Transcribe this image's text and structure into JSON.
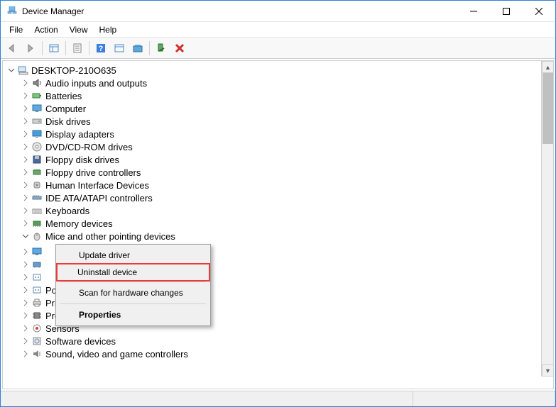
{
  "window": {
    "title": "Device Manager"
  },
  "menu": {
    "items": [
      "File",
      "Action",
      "View",
      "Help"
    ]
  },
  "root": {
    "name": "DESKTOP-210O635"
  },
  "categories": [
    {
      "label": "Audio inputs and outputs",
      "icon": "speaker-icon"
    },
    {
      "label": "Batteries",
      "icon": "battery-icon"
    },
    {
      "label": "Computer",
      "icon": "monitor-icon"
    },
    {
      "label": "Disk drives",
      "icon": "disk-icon"
    },
    {
      "label": "Display adapters",
      "icon": "display-icon"
    },
    {
      "label": "DVD/CD-ROM drives",
      "icon": "cdrom-icon"
    },
    {
      "label": "Floppy disk drives",
      "icon": "floppy-icon"
    },
    {
      "label": "Floppy drive controllers",
      "icon": "controller-icon"
    },
    {
      "label": "Human Interface Devices",
      "icon": "hid-icon"
    },
    {
      "label": "IDE ATA/ATAPI controllers",
      "icon": "ide-icon"
    },
    {
      "label": "Keyboards",
      "icon": "keyboard-icon"
    },
    {
      "label": "Memory devices",
      "icon": "memory-icon"
    },
    {
      "label": "Mice and other pointing devices",
      "icon": "mouse-icon",
      "expanded": true
    },
    {
      "label": "",
      "icon": "monitor-icon",
      "obscured": true
    },
    {
      "label": "",
      "icon": "network-icon",
      "obscured": true
    },
    {
      "label": "",
      "icon": "port-icon",
      "obscured": true
    },
    {
      "label": "Ports (COM & LPT)",
      "icon": "port-icon"
    },
    {
      "label": "Print queues",
      "icon": "printer-icon"
    },
    {
      "label": "Processors",
      "icon": "cpu-icon"
    },
    {
      "label": "Sensors",
      "icon": "sensor-icon"
    },
    {
      "label": "Software devices",
      "icon": "software-icon"
    },
    {
      "label": "Sound, video and game controllers",
      "icon": "sound-icon",
      "cut": true
    }
  ],
  "context_menu": {
    "items": [
      {
        "label": "Update driver"
      },
      {
        "label": "Uninstall device",
        "highlighted": true
      },
      {
        "sep": true
      },
      {
        "label": "Scan for hardware changes"
      },
      {
        "sep": true
      },
      {
        "label": "Properties",
        "bold": true
      }
    ]
  }
}
